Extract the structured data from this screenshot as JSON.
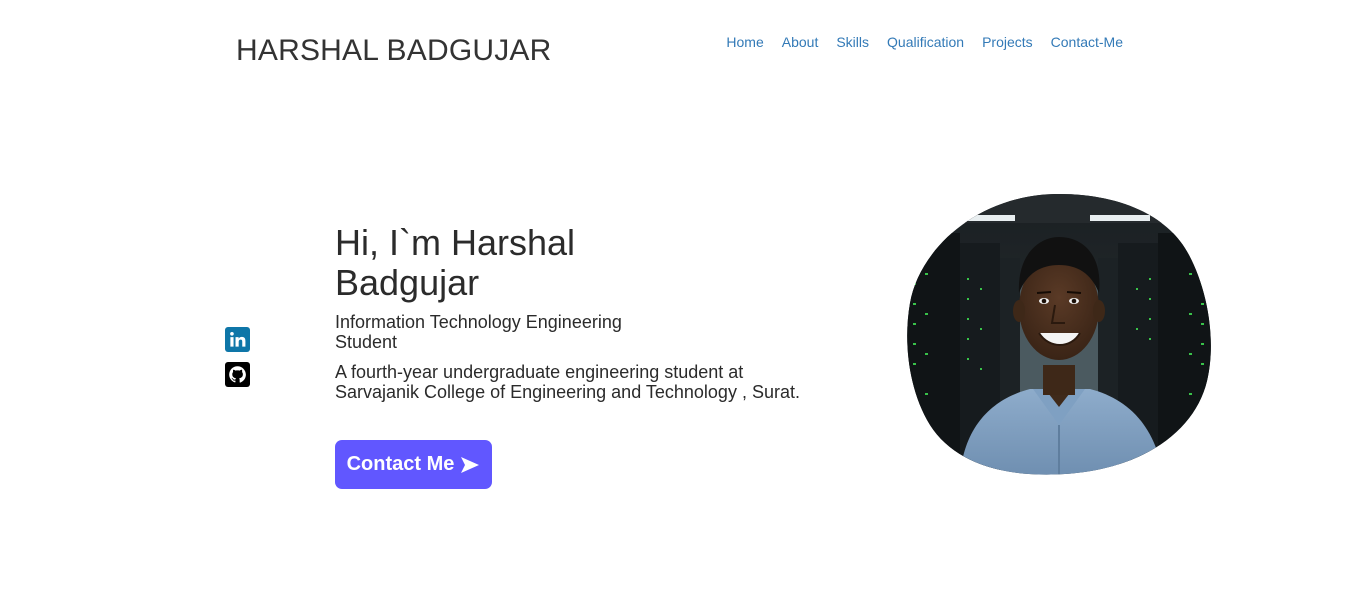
{
  "header": {
    "brand": "HARSHAL BADGUJAR",
    "nav": [
      "Home",
      "About",
      "Skills",
      "Qualification",
      "Projects",
      "Contact-Me"
    ]
  },
  "social": {
    "icons": [
      "linkedin-icon",
      "github-icon"
    ],
    "colors": {
      "linkedin": "#0e76a8",
      "github": "#000000"
    }
  },
  "hero": {
    "title": "Hi, I`m Harshal Badgujar",
    "role": "Information Technology Engineering Student",
    "description": "A fourth-year undergraduate engineering student at Sarvajanik College of Engineering and Technology , Surat.",
    "button_label": "Contact Me",
    "button_icon": "send-arrow-icon",
    "accent_color": "#6157ff"
  },
  "portrait": {
    "subject": "profile-photo"
  }
}
